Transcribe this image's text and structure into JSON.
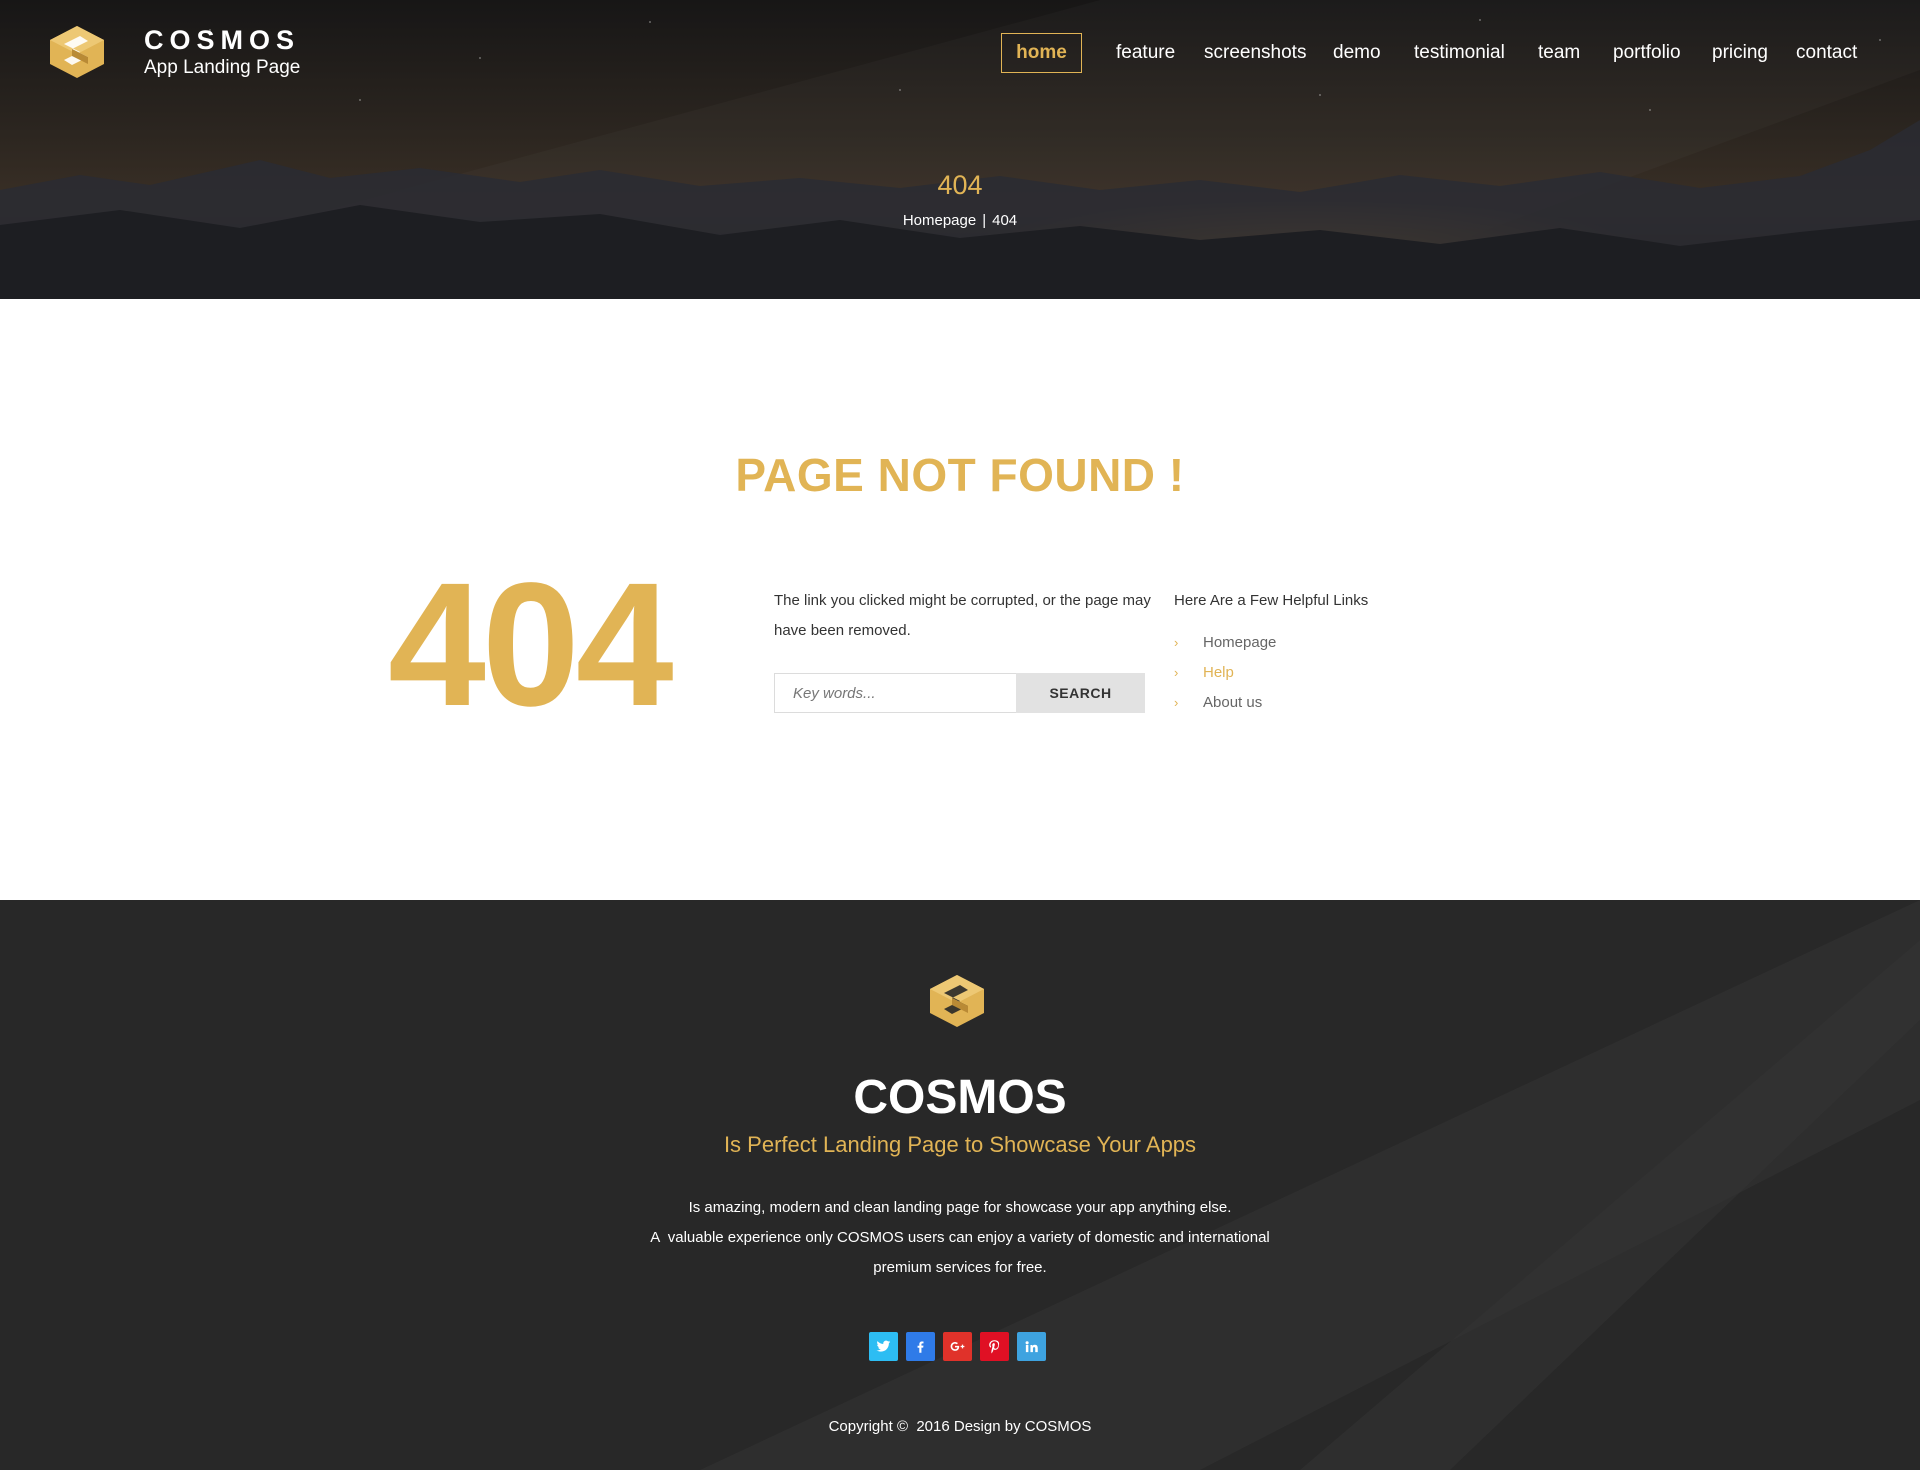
{
  "header": {
    "brand_name": "COSMOS",
    "brand_sub": "App Landing Page",
    "nav": [
      {
        "label": "home",
        "active": true
      },
      {
        "label": "feature"
      },
      {
        "label": "screenshots"
      },
      {
        "label": "demo"
      },
      {
        "label": "testimonial"
      },
      {
        "label": "team"
      },
      {
        "label": "portfolio"
      },
      {
        "label": "pricing"
      },
      {
        "label": "contact"
      }
    ]
  },
  "hero": {
    "title": "404",
    "breadcrumb": {
      "home": "Homepage",
      "separator": "|",
      "current": "404"
    }
  },
  "main": {
    "heading": "PAGE NOT FOUND !",
    "code": "404",
    "message": "The link you clicked might be corrupted, or the page may have been removed.",
    "search": {
      "placeholder": "Key words...",
      "button": "SEARCH"
    },
    "links_title": "Here Are a Few Helpful Links",
    "links": [
      {
        "label": "Homepage"
      },
      {
        "label": "Help"
      },
      {
        "label": "About us"
      }
    ]
  },
  "footer": {
    "brand": "COSMOS",
    "tagline": "Is Perfect Landing Page to Showcase Your Apps",
    "desc_line1": "Is amazing, modern and clean landing page for showcase your app anything else.",
    "desc_line2": "A  valuable experience only COSMOS users can enjoy a variety of domestic and international",
    "desc_line3": "premium services for free.",
    "social": [
      {
        "icon": "twitter-icon",
        "color": "#2dbdf3"
      },
      {
        "icon": "facebook-icon",
        "color": "#2f7be8"
      },
      {
        "icon": "google-plus-icon",
        "color": "#e0322a"
      },
      {
        "icon": "pinterest-icon",
        "color": "#e01024"
      },
      {
        "icon": "linkedin-icon",
        "color": "#3ea3e0"
      }
    ],
    "copyright": "Copyright ©  2016 Design by COSMOS"
  },
  "colors": {
    "accent": "#e1b455",
    "footer_bg": "#282828",
    "text": "#333333"
  }
}
